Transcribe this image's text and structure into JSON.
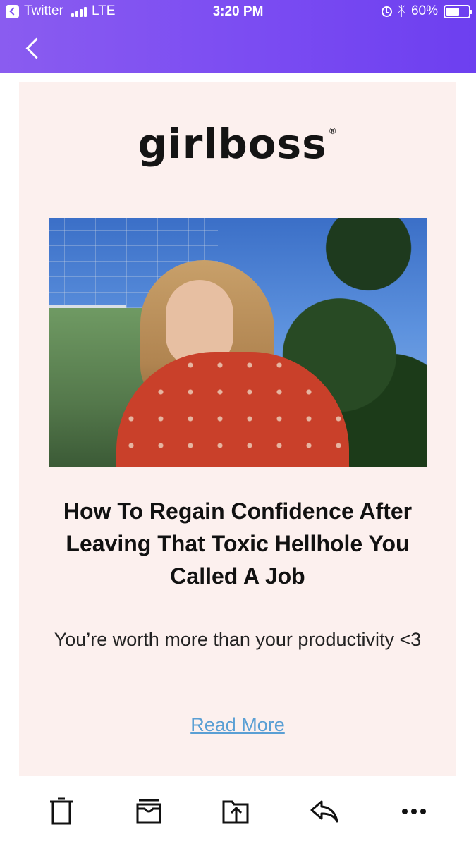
{
  "status_bar": {
    "back_app": "Twitter",
    "network": "LTE",
    "time": "3:20 PM",
    "battery": "60%",
    "battery_level": 0.6
  },
  "email": {
    "brand_logo": "girlboss",
    "brand_mark": "®",
    "headline": "How To Regain Confidence After Leaving That Toxic Hellhole You Called A Job",
    "subtitle": "You’re worth more than your productivity <3",
    "cta": "Read More"
  },
  "icons": {
    "back": "chevron-left-icon",
    "toolbar": [
      "trash-icon",
      "archive-icon",
      "move-icon",
      "reply-icon",
      "more-icon"
    ]
  },
  "colors": {
    "header_start": "#8a5cf0",
    "header_end": "#6d3ff0",
    "card_background": "#fcf0ee",
    "link": "#5a9fd4"
  }
}
